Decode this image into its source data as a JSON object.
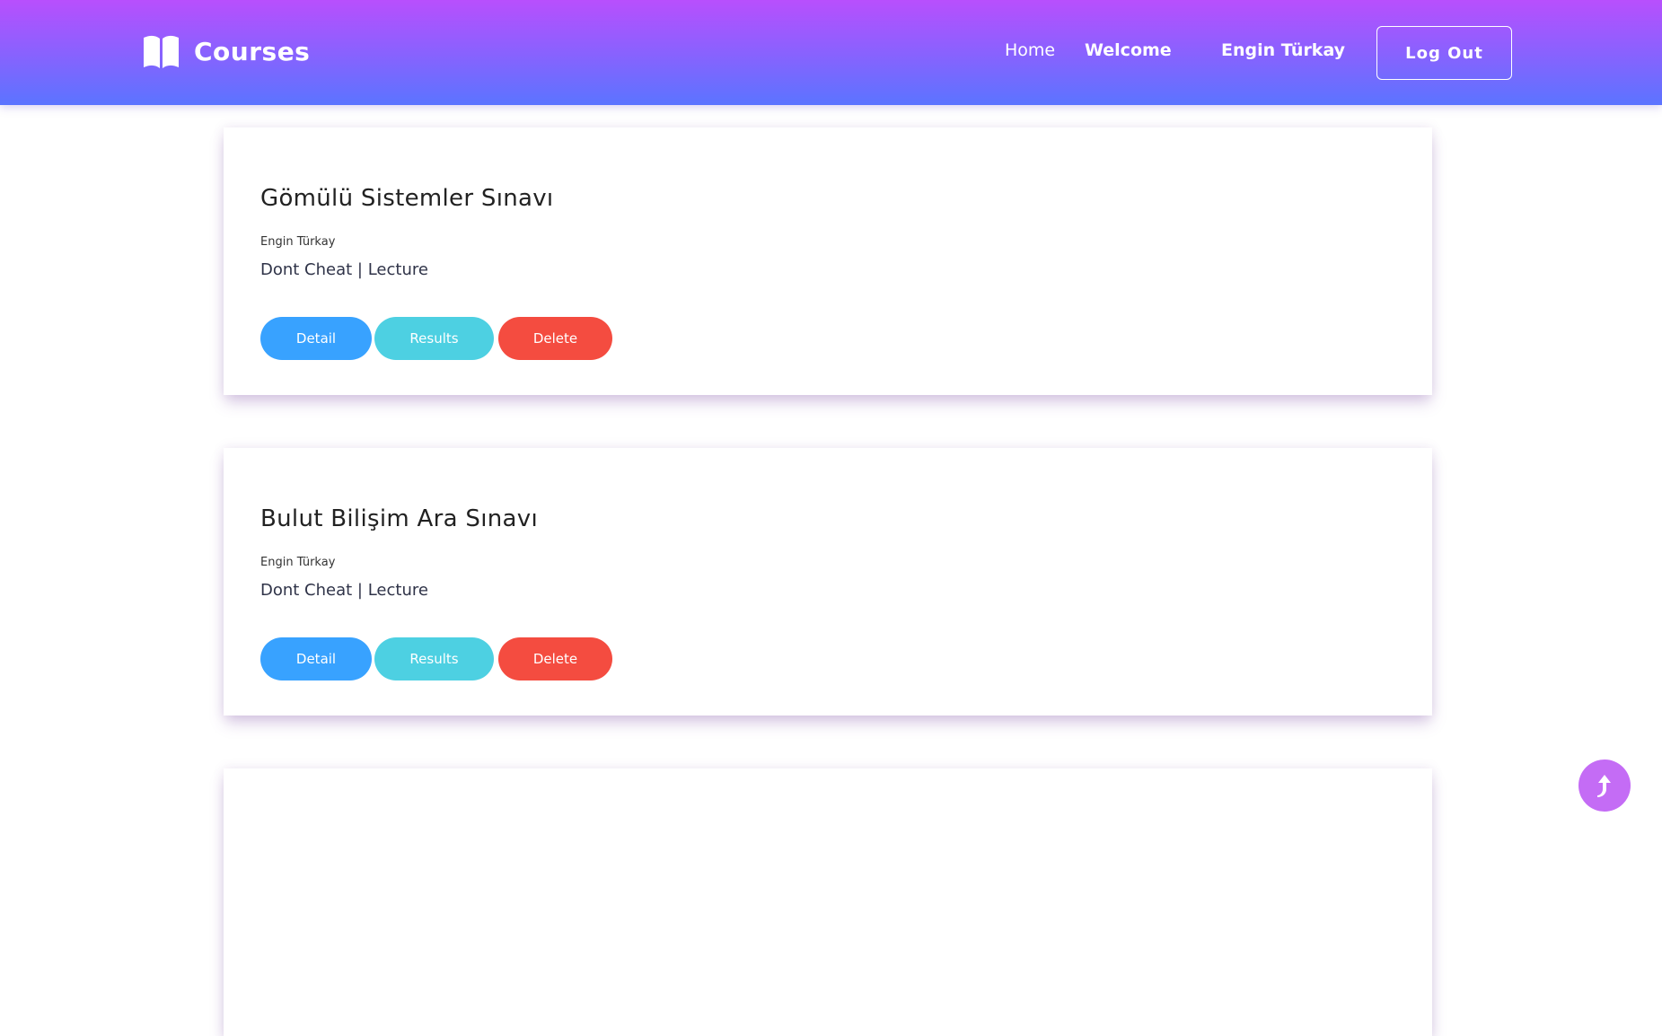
{
  "navbar": {
    "brand_icon": "book-open-icon",
    "brand": "Courses",
    "links": {
      "home": "Home",
      "welcome": "Welcome",
      "user": "Engin Türkay"
    },
    "logout_label": "Log Out",
    "gradient": [
      "#b84ffd",
      "#5b74ff"
    ]
  },
  "exams": [
    {
      "title": "Gömülü Sistemler Sınavı",
      "author": "Engin Türkay",
      "description": "Dont Cheat | Lecture",
      "buttons": {
        "detail": "Detail",
        "results": "Results",
        "delete": "Delete"
      }
    },
    {
      "title": "Bulut Bilişim Ara Sınavı",
      "author": "Engin Türkay",
      "description": "Dont Cheat | Lecture",
      "buttons": {
        "detail": "Detail",
        "results": "Results",
        "delete": "Delete"
      }
    }
  ],
  "colors": {
    "detail": "#38a2ff",
    "results": "#4dd0e2",
    "delete": "#f44c40",
    "scroll_top": "#c46cf5"
  },
  "scroll_top_icon": "arrow-up-icon"
}
